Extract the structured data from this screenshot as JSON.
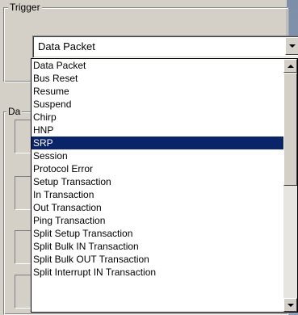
{
  "trigger_group": {
    "legend": "Trigger"
  },
  "data_group": {
    "legend_partial": "Da"
  },
  "combo": {
    "selected_value": "Data Packet"
  },
  "dropdown": {
    "items": [
      "Data Packet",
      "Bus Reset",
      "Resume",
      "Suspend",
      "Chirp",
      "HNP",
      "SRP",
      "Session",
      "Protocol Error",
      "Setup Transaction",
      "In Transaction",
      "Out Transaction",
      "Ping Transaction",
      "Split Setup  Transaction",
      "Split Bulk  IN Transaction",
      "Split Bulk OUT Transaction",
      "Split Interrupt IN Transaction"
    ],
    "selected_item": "SRP"
  },
  "icons": {
    "combo_arrow": "chevron-down-icon",
    "scroll_up": "scroll-up-icon",
    "scroll_down": "scroll-down-icon"
  },
  "colors": {
    "selection_bg": "#0a246a",
    "selection_fg": "#ffffff",
    "dialog_bg": "#d4d0c8"
  }
}
